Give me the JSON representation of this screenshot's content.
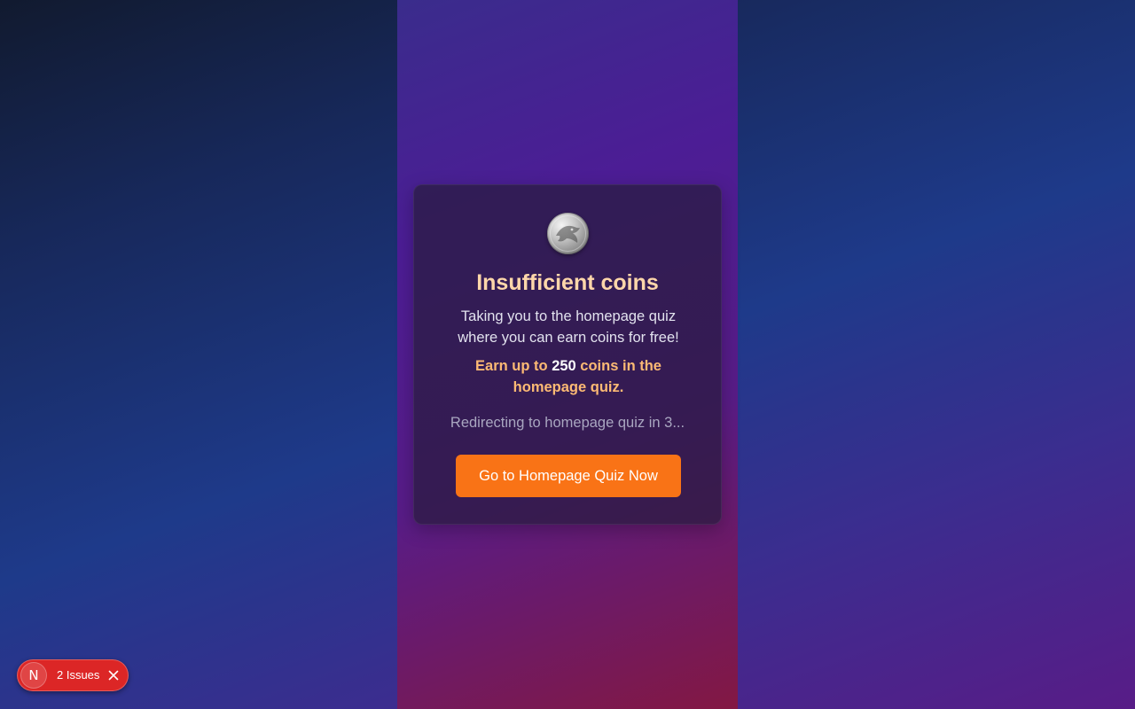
{
  "modal": {
    "coin_icon": "coin-icon",
    "title": "Insufficient coins",
    "description": "Taking you to the homepage quiz where you can earn coins for free!",
    "earn_prefix": "Earn up to ",
    "earn_amount": "250",
    "earn_suffix": " coins in the homepage quiz.",
    "redirect_text": "Redirecting to homepage quiz in 3...",
    "cta_label": "Go to Homepage Quiz Now"
  },
  "dev_overlay": {
    "badge_letter": "N",
    "issues_label": "2 Issues",
    "close_icon": "close-icon"
  },
  "colors": {
    "accent": "#f97316",
    "title": "#fed7aa",
    "earn_text": "#fdba74",
    "issues_badge": "#dc2626"
  }
}
